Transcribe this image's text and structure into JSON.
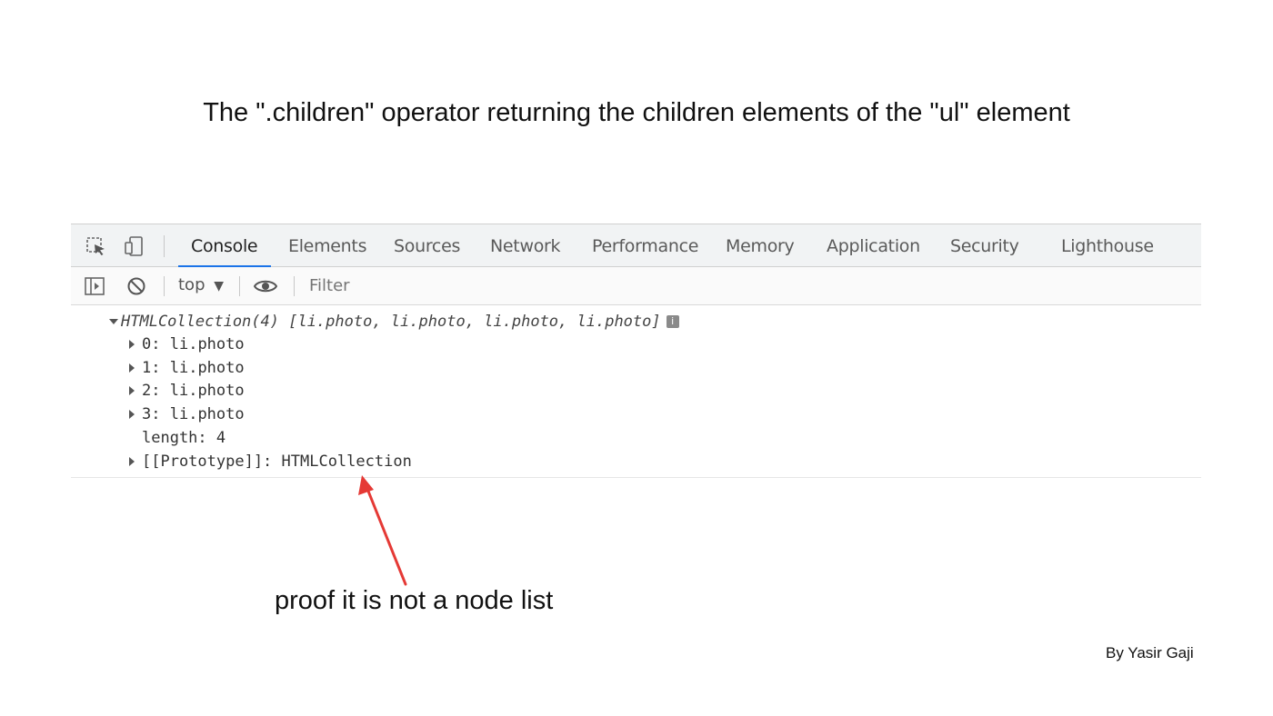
{
  "page": {
    "title": "The \".children\" operator returning the children elements of the \"ul\" element",
    "annotation": "proof it is not a node list",
    "author": "By Yasir Gaji"
  },
  "devtools": {
    "tabs": [
      {
        "label": "Console",
        "active": true
      },
      {
        "label": "Elements"
      },
      {
        "label": "Sources"
      },
      {
        "label": "Network"
      },
      {
        "label": "Performance"
      },
      {
        "label": "Memory"
      },
      {
        "label": "Application"
      },
      {
        "label": "Security"
      },
      {
        "label": "Lighthouse"
      }
    ],
    "toolbar": {
      "context": "top",
      "context_arrow": "▼",
      "filter_placeholder": "Filter"
    },
    "console": {
      "summary": "HTMLCollection(4) [li.photo, li.photo, li.photo, li.photo]",
      "info_badge": "i",
      "items": [
        {
          "key": "0",
          "value": "li.photo"
        },
        {
          "key": "1",
          "value": "li.photo"
        },
        {
          "key": "2",
          "value": "li.photo"
        },
        {
          "key": "3",
          "value": "li.photo"
        }
      ],
      "length_line": "length: 4",
      "prototype_line": "[[Prototype]]: HTMLCollection"
    }
  },
  "colors": {
    "accent": "#1a73e8",
    "arrow": "#e53935"
  },
  "icons": [
    "inspect-element-icon",
    "device-toolbar-icon",
    "sidebar-toggle-icon",
    "clear-console-icon",
    "eye-icon",
    "expand-triangle-icon",
    "collapse-triangle-icon",
    "info-icon"
  ]
}
